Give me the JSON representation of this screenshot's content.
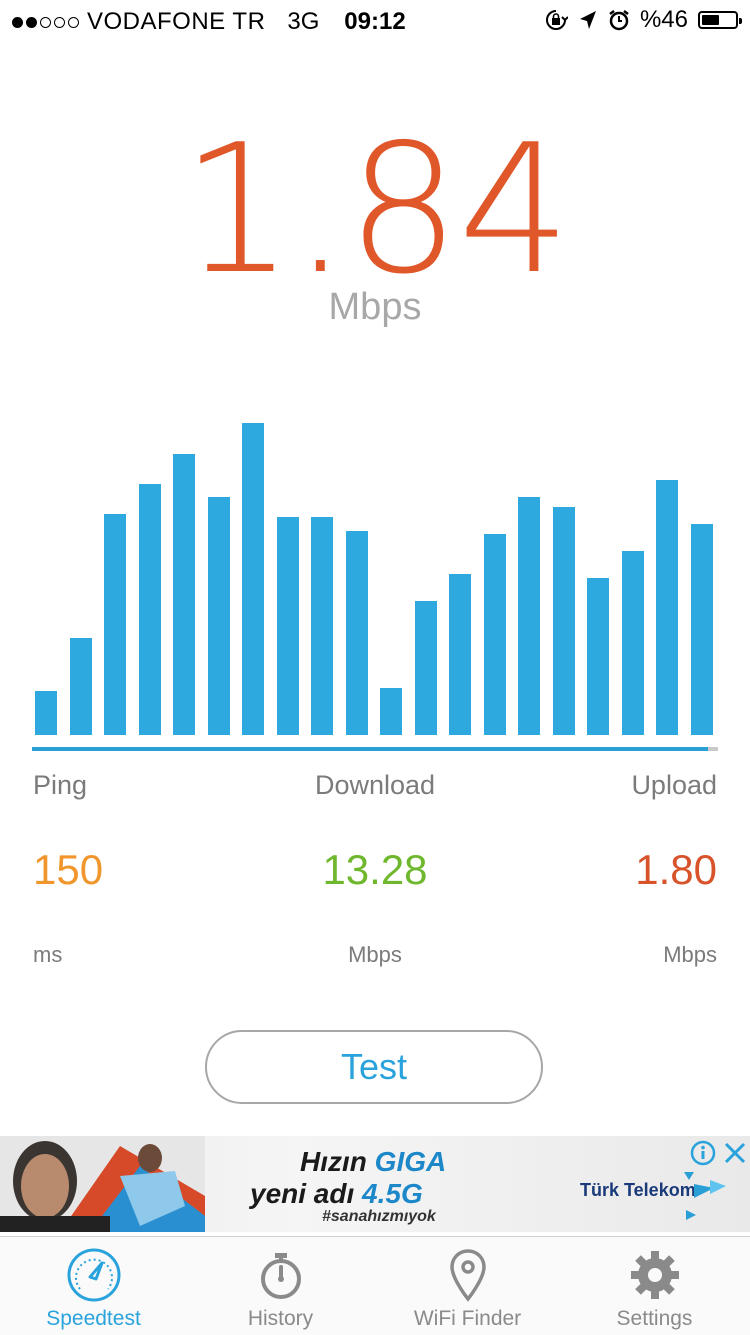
{
  "status_bar": {
    "carrier": "VODAFONE TR",
    "network": "3G",
    "time": "09:12",
    "battery": "%46",
    "signal_bars_filled": 2,
    "signal_bars_total": 5
  },
  "result": {
    "value": "1.84",
    "unit": "Mbps"
  },
  "chart_data": {
    "type": "bar",
    "values": [
      13,
      29,
      66,
      75,
      84,
      71,
      93,
      65,
      65,
      61,
      14,
      40,
      48,
      60,
      71,
      68,
      47,
      55,
      76,
      63
    ],
    "progress": 0.985,
    "colors": {
      "bar": "#2ea9e0",
      "progress": "#2a9fd6",
      "track": "#c9c9c9"
    }
  },
  "stats": {
    "ping": {
      "label": "Ping",
      "value": "150",
      "unit": "ms",
      "color": "#f0962d"
    },
    "download": {
      "label": "Download",
      "value": "13.28",
      "unit": "Mbps",
      "color": "#6fb82e"
    },
    "upload": {
      "label": "Upload",
      "value": "1.80",
      "unit": "Mbps",
      "color": "#d8532a"
    }
  },
  "test_button": {
    "label": "Test"
  },
  "ad": {
    "line1_prefix": "Hızın ",
    "line1_highlight": "GIGA",
    "line2_prefix": "yeni adı ",
    "line2_highlight": "4.5G",
    "hashtag": "#sanahızmıyok",
    "brand": "Türk Telekom"
  },
  "tabs": [
    {
      "label": "Speedtest",
      "icon": "speedometer-icon",
      "active": true
    },
    {
      "label": "History",
      "icon": "stopwatch-icon",
      "active": false
    },
    {
      "label": "WiFi Finder",
      "icon": "location-pin-icon",
      "active": false
    },
    {
      "label": "Settings",
      "icon": "gear-icon",
      "active": false
    }
  ]
}
